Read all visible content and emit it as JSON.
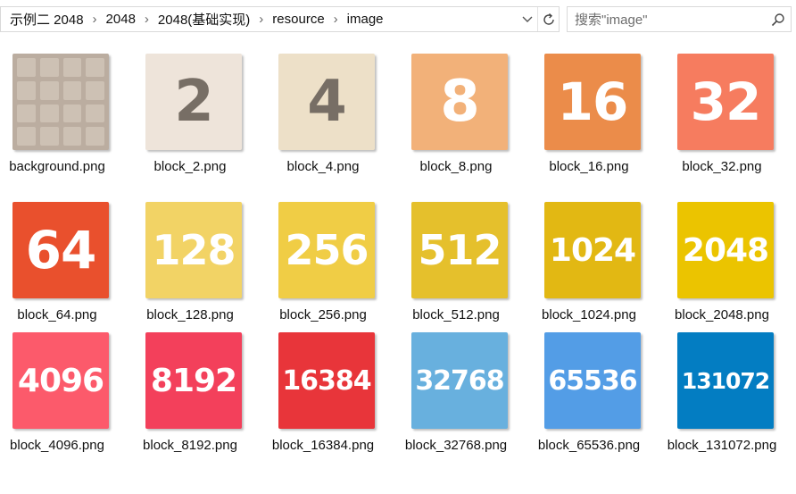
{
  "address": {
    "breadcrumbs": [
      "示例二 2048",
      "2048",
      "2048(基础实现)",
      "resource",
      "image"
    ],
    "separator": "›"
  },
  "search": {
    "placeholder": "搜索\"image\""
  },
  "files": [
    {
      "name": "background.png",
      "number": "",
      "bg": "#bbada0",
      "fg": "#ffffff"
    },
    {
      "name": "block_2.png",
      "number": "2",
      "bg": "#eee4da",
      "fg": "#776e65"
    },
    {
      "name": "block_4.png",
      "number": "4",
      "bg": "#ede0c8",
      "fg": "#776e65"
    },
    {
      "name": "block_8.png",
      "number": "8",
      "bg": "#f2b179",
      "fg": "#ffffff"
    },
    {
      "name": "block_16.png",
      "number": "16",
      "bg": "#eb8c4a",
      "fg": "#ffffff"
    },
    {
      "name": "block_32.png",
      "number": "32",
      "bg": "#f67c5f",
      "fg": "#ffffff"
    },
    {
      "name": "block_64.png",
      "number": "64",
      "bg": "#e9502d",
      "fg": "#ffffff"
    },
    {
      "name": "block_128.png",
      "number": "128",
      "bg": "#f2d365",
      "fg": "#ffffff"
    },
    {
      "name": "block_256.png",
      "number": "256",
      "bg": "#f0cd45",
      "fg": "#ffffff"
    },
    {
      "name": "block_512.png",
      "number": "512",
      "bg": "#e5c02c",
      "fg": "#ffffff"
    },
    {
      "name": "block_1024.png",
      "number": "1024",
      "bg": "#e2b813",
      "fg": "#ffffff"
    },
    {
      "name": "block_2048.png",
      "number": "2048",
      "bg": "#ebc400",
      "fg": "#ffffff"
    },
    {
      "name": "block_4096.png",
      "number": "4096",
      "bg": "#fc5a6b",
      "fg": "#ffffff"
    },
    {
      "name": "block_8192.png",
      "number": "8192",
      "bg": "#f3405b",
      "fg": "#ffffff"
    },
    {
      "name": "block_16384.png",
      "number": "16384",
      "bg": "#e8353a",
      "fg": "#ffffff"
    },
    {
      "name": "block_32768.png",
      "number": "32768",
      "bg": "#68b0de",
      "fg": "#ffffff"
    },
    {
      "name": "block_65536.png",
      "number": "65536",
      "bg": "#539de6",
      "fg": "#ffffff"
    },
    {
      "name": "block_131072.png",
      "number": "131072",
      "bg": "#037dc2",
      "fg": "#ffffff"
    }
  ]
}
